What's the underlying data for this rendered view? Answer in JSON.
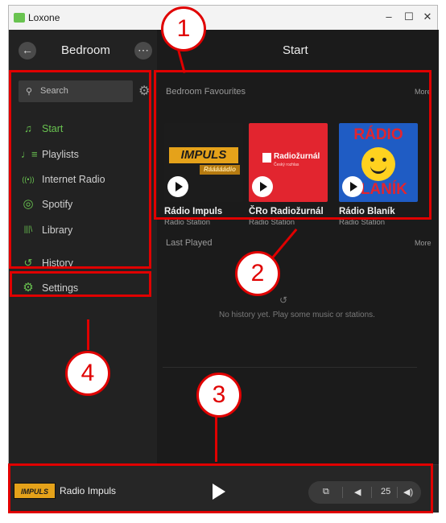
{
  "window": {
    "title": "Loxone",
    "minimize": "–",
    "maximize": "☐",
    "close": "✕"
  },
  "sidebar": {
    "back_icon": "←",
    "room_title": "Bedroom",
    "more_icon": "⋯",
    "search_placeholder": "Search",
    "search_icon": "⚲",
    "gear_icon": "⚙",
    "items": [
      {
        "label": "Start",
        "icon": "♫",
        "active": true
      },
      {
        "label": "Playlists",
        "icon": "♩≡"
      },
      {
        "label": "Internet Radio",
        "icon": "((•))"
      },
      {
        "label": "Spotify",
        "icon": "◎"
      },
      {
        "label": "Library",
        "icon": "|||\\"
      },
      {
        "label": "History",
        "icon": "↺"
      }
    ],
    "settings": {
      "label": "Settings",
      "icon": "⚙"
    }
  },
  "main": {
    "title": "Start",
    "favourites": {
      "title": "Bedroom Favourites",
      "more": "More",
      "items": [
        {
          "name": "Rádio Impuls",
          "type": "Radio Station",
          "logo_main": "IMPULS",
          "logo_sub": "Rááááádio"
        },
        {
          "name": "ČRo Radiožurnál",
          "type": "Radio Station",
          "logo_main": "Radiožurnál",
          "logo_sub": "Český rozhlas"
        },
        {
          "name": "Rádio Blaník",
          "type": "Radio Station",
          "logo_top": "RÁDIO",
          "logo_bottom": "BLANÍK"
        }
      ]
    },
    "last_played": {
      "title": "Last Played",
      "more": "More",
      "empty_icon": "↺",
      "empty_text": "No history yet. Play some music or stations."
    }
  },
  "player": {
    "logo": "IMPULS",
    "title": "Radio Impuls",
    "group_icon": "⧉",
    "vol_down": "◀",
    "volume": "25",
    "vol_up": "◀)"
  },
  "annotations": [
    {
      "label": "1"
    },
    {
      "label": "2"
    },
    {
      "label": "3"
    },
    {
      "label": "4"
    }
  ],
  "colors": {
    "accent": "#69c350",
    "annotation": "#e00000",
    "background": "#1c1c1c"
  }
}
